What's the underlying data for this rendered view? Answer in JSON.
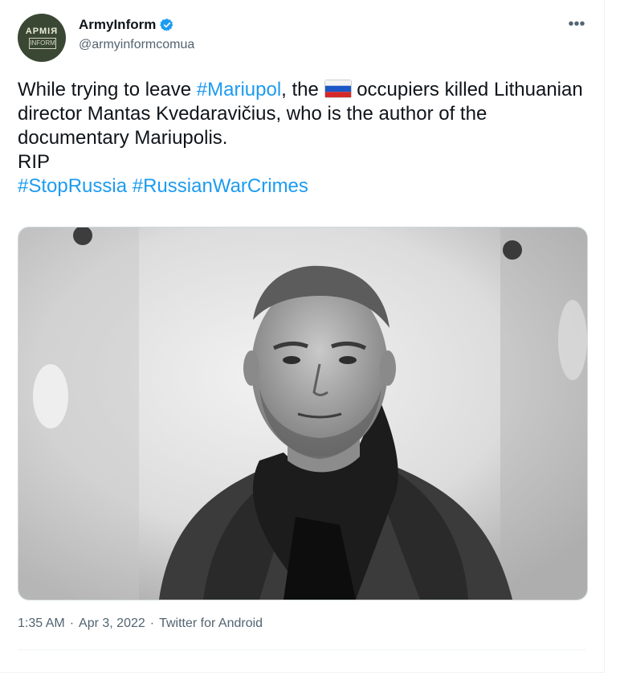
{
  "author": {
    "avatar_line1": "АРМІЯ",
    "avatar_line2": "INFORM",
    "display_name": "ArmyInform",
    "handle": "@armyinformcomua"
  },
  "more_icon": "more-options-icon",
  "tweet": {
    "seg1": "While trying to leave ",
    "hashtag1": "#Mariupol",
    "seg2": ", the ",
    "seg3": " occupiers killed Lithuanian director Mantas Kvedaravičius, who is the author of the documentary Mariupolis.",
    "seg4": "RIP",
    "hashtag2": "#StopRussia",
    "hashtag3": "#RussianWarCrimes"
  },
  "meta": {
    "time": "1:35 AM",
    "sep1": "·",
    "date": "Apr 3, 2022",
    "sep2": "·",
    "source": "Twitter for Android"
  },
  "colors": {
    "link": "#1d9bf0",
    "verified": "#1d9bf0",
    "secondary_text": "#536471"
  }
}
